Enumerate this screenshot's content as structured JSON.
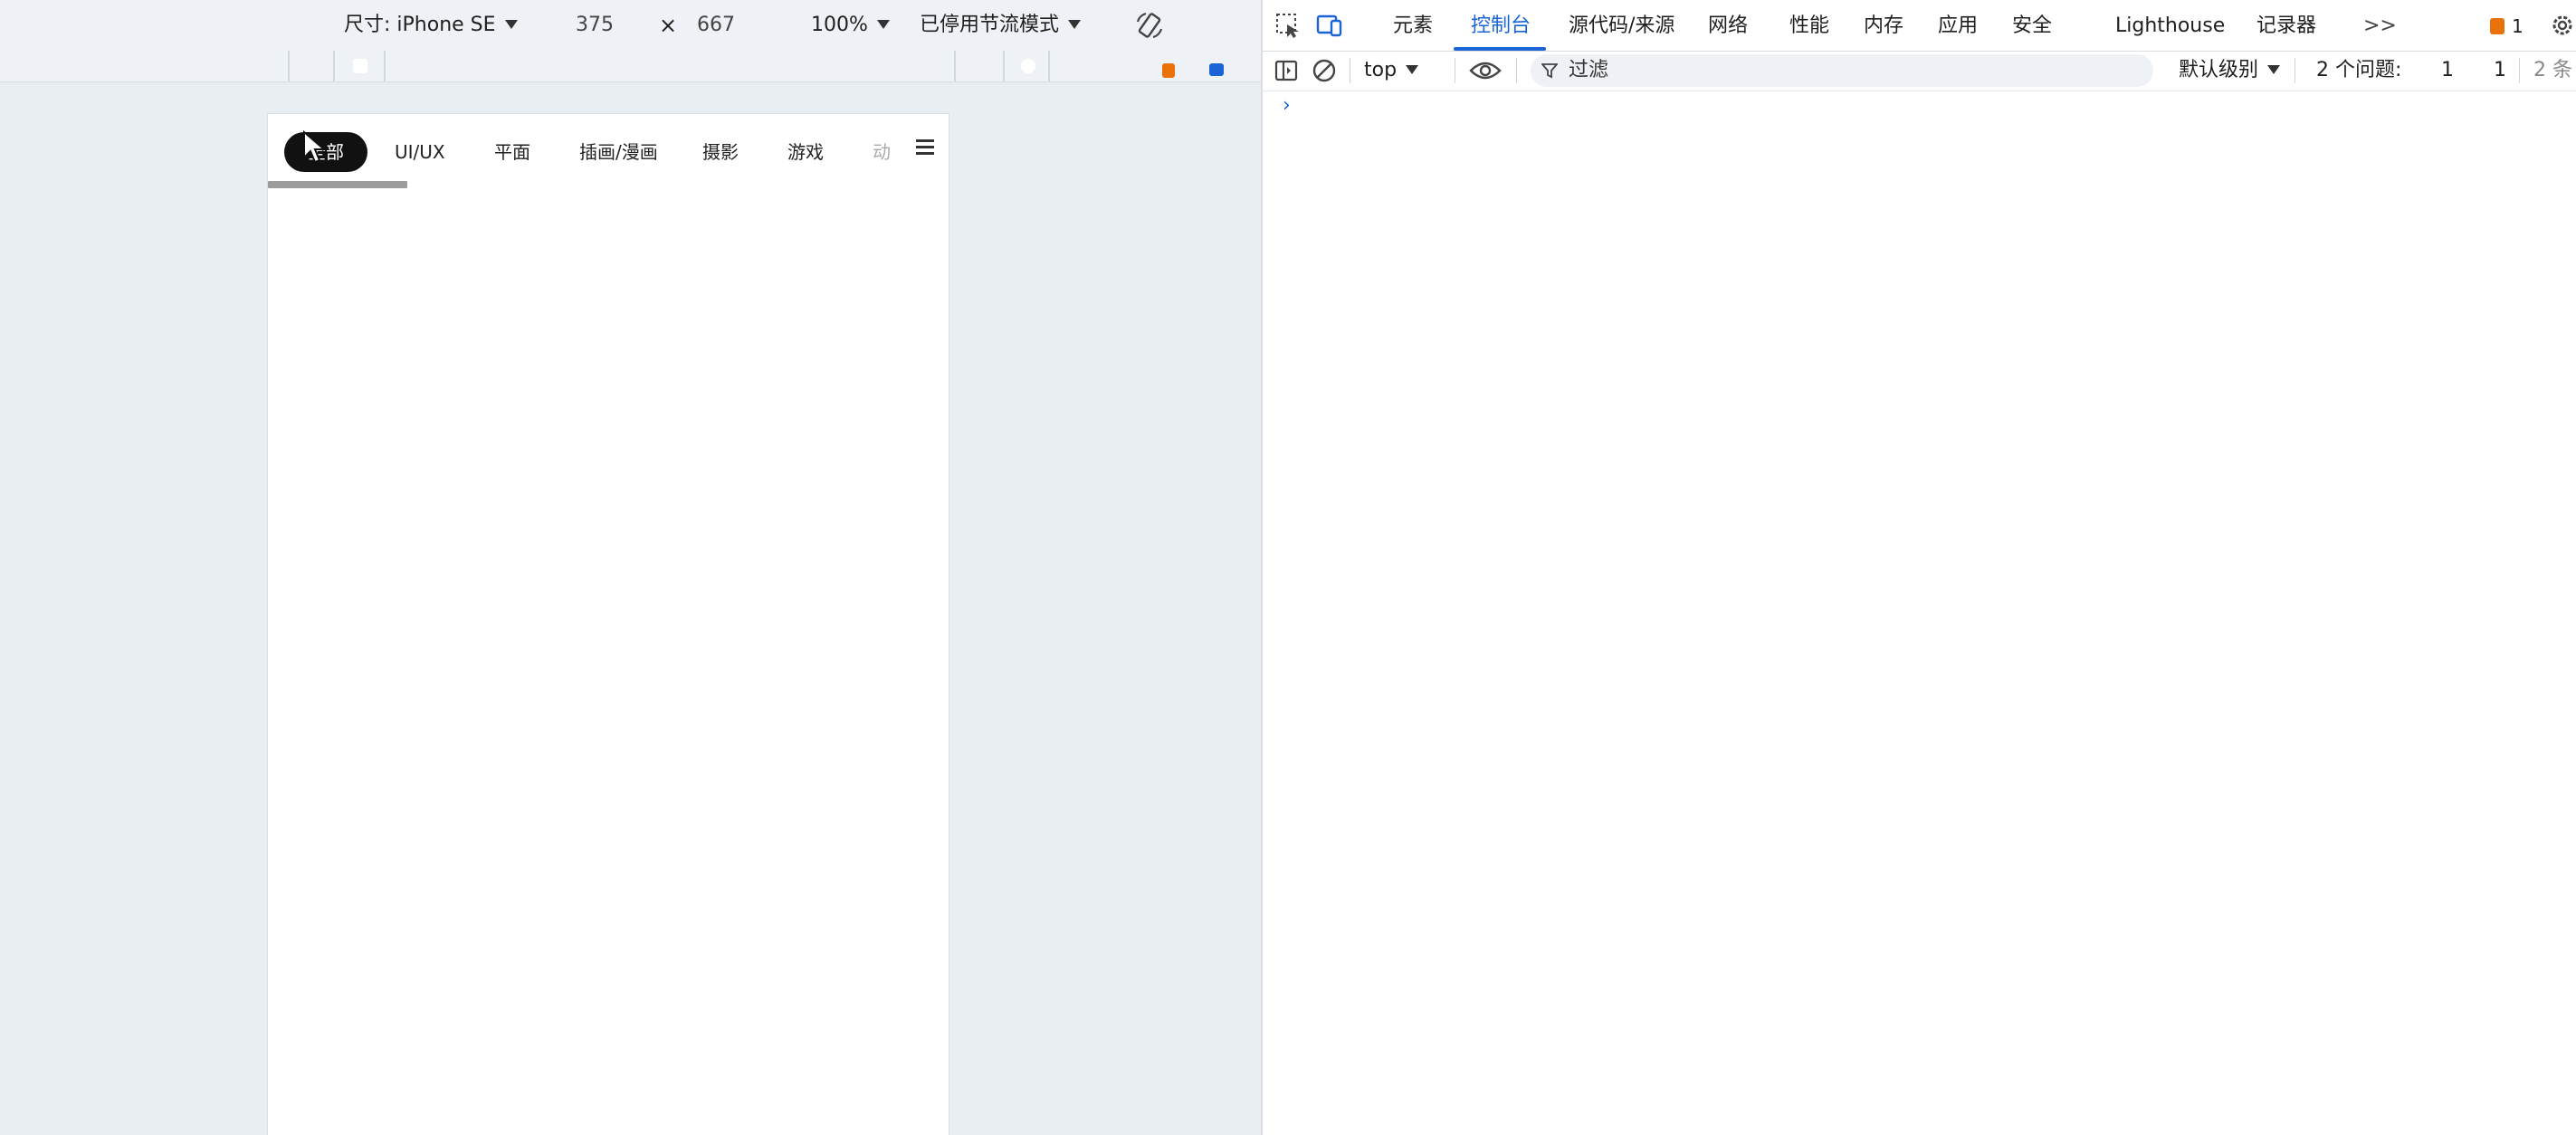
{
  "emulation": {
    "size_label": "尺寸: iPhone SE",
    "width": "375",
    "times": "×",
    "height": "667",
    "zoom": "100%",
    "throttle": "已停用节流模式"
  },
  "page": {
    "tabs": [
      "全部",
      "UI/UX",
      "平面",
      "插画/漫画",
      "摄影",
      "游戏",
      "动"
    ],
    "active_tab": 0,
    "menu_icon": "hamburger-icon"
  },
  "devtools": {
    "tabs": [
      "元素",
      "控制台",
      "源代码/来源",
      "网络",
      "性能",
      "内存",
      "应用",
      "安全",
      "Lighthouse",
      "记录器"
    ],
    "active_tab": "控制台",
    "overflow": ">>",
    "issue_count_top": "1",
    "console": {
      "context": "top",
      "filter_placeholder": "过滤",
      "level": "默认级别",
      "issues_label": "2 个问题:",
      "issues_warn": "1",
      "issues_info": "1",
      "hidden_count": "2 条",
      "prompt": "›"
    },
    "colors": {
      "accent": "#1a64d6",
      "warning": "#e8710a",
      "info": "#1a64d6"
    }
  }
}
